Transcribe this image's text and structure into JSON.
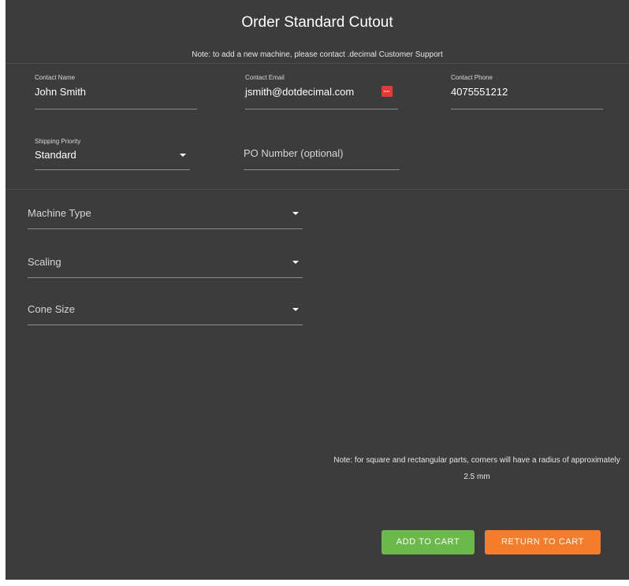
{
  "dialog": {
    "title": "Order Standard Cutout",
    "note_top": "Note: to add a new machine, please contact .decimal Customer Support",
    "note_bottom": "Note: for square and rectangular parts, corners will have a radius of approximately 2.5 mm"
  },
  "contact": {
    "name": {
      "label": "Contact Name",
      "value": "John Smith"
    },
    "email": {
      "label": "Contact Email",
      "value": "jsmith@dotdecimal.com",
      "icon": "password-manager-icon",
      "icon_color": "#e53935"
    },
    "phone": {
      "label": "Contact Phone",
      "value": "4075551212"
    }
  },
  "order": {
    "shipping_priority": {
      "label": "Shipping Priority",
      "value": "Standard"
    },
    "po_number": {
      "placeholder": "PO Number (optional)"
    }
  },
  "machine": {
    "machine_type": {
      "placeholder": "Machine Type"
    },
    "scaling": {
      "placeholder": "Scaling"
    },
    "cone_size": {
      "placeholder": "Cone Size"
    }
  },
  "actions": {
    "add_to_cart": {
      "label": "ADD TO CART",
      "color": "#6ab94a"
    },
    "return_to_cart": {
      "label": "RETURN TO CART",
      "color": "#f57c2a"
    }
  },
  "colors": {
    "background": "#3c3c3c",
    "text": "#ffffff",
    "underline": "#8c8c8c"
  }
}
